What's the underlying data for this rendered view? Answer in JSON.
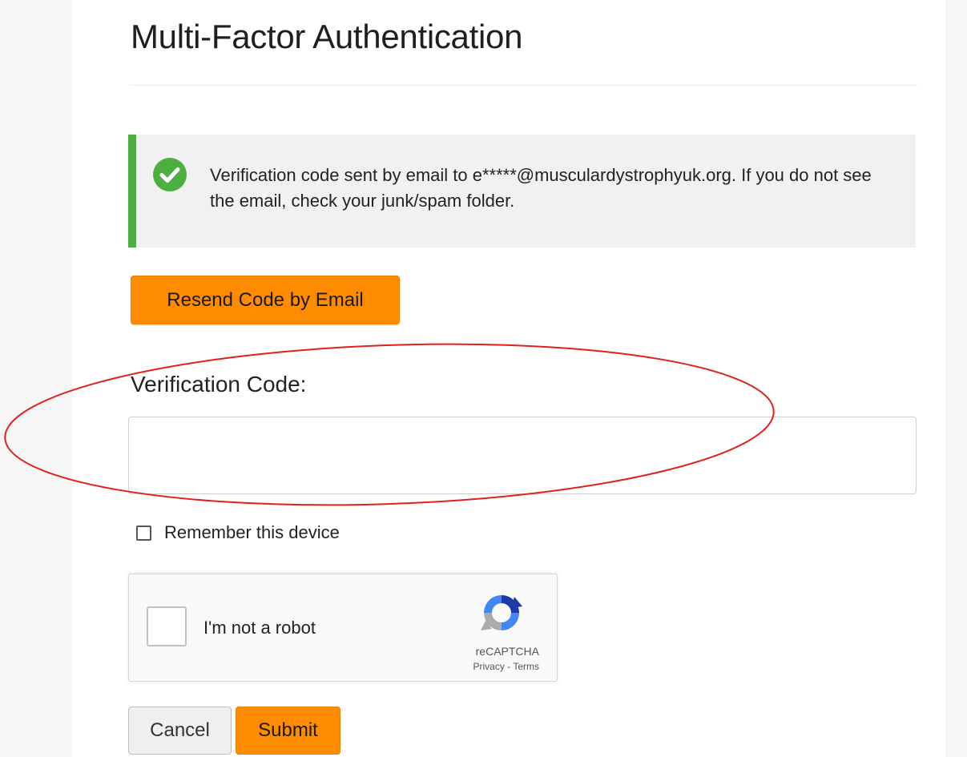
{
  "page": {
    "title": "Multi-Factor Authentication"
  },
  "alert": {
    "icon": "check-circle-icon",
    "message": "Verification code sent by email to e*****@musculardystrophyuk.org. If you do not see the email, check your junk/spam folder.",
    "accent_color": "#4caf3f"
  },
  "resend": {
    "label": "Resend Code by Email"
  },
  "verification": {
    "label": "Verification Code:",
    "value": "",
    "placeholder": ""
  },
  "remember": {
    "label": "Remember this device",
    "checked": false
  },
  "recaptcha": {
    "label": "I'm not a robot",
    "brand": "reCAPTCHA",
    "privacy": "Privacy",
    "separator": "-",
    "terms": "Terms",
    "logo_icon": "recaptcha-logo-icon"
  },
  "actions": {
    "cancel_label": "Cancel",
    "submit_label": "Submit"
  },
  "colors": {
    "primary_button": "#ff8c00",
    "annotation_ellipse": "#e0201c"
  }
}
